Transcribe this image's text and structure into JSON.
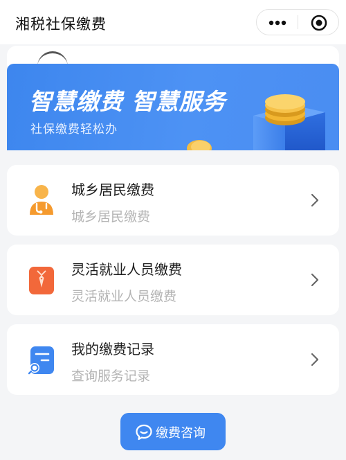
{
  "app": {
    "title": "湘税社保缴费"
  },
  "capsule": {
    "more_icon": "more-dots-icon",
    "close_icon": "target-close-icon"
  },
  "banner": {
    "title": "智慧缴费  智慧服务",
    "subtitle": "社保缴费轻松办",
    "background_color": "#4a8df2"
  },
  "services": [
    {
      "title": "城乡居民缴费",
      "subtitle": "城乡居民缴费",
      "icon": "resident-person-icon",
      "icon_color": "#f7a13a"
    },
    {
      "title": "灵活就业人员缴费",
      "subtitle": "灵活就业人员缴费",
      "icon": "employee-tie-icon",
      "icon_color": "#f2683a"
    },
    {
      "title": "我的缴费记录",
      "subtitle": "查询服务记录",
      "icon": "record-search-icon",
      "icon_color": "#3f87f0"
    }
  ],
  "consult": {
    "label": "缴费咨询",
    "icon": "chat-bubble-icon",
    "color": "#3f87f0"
  }
}
